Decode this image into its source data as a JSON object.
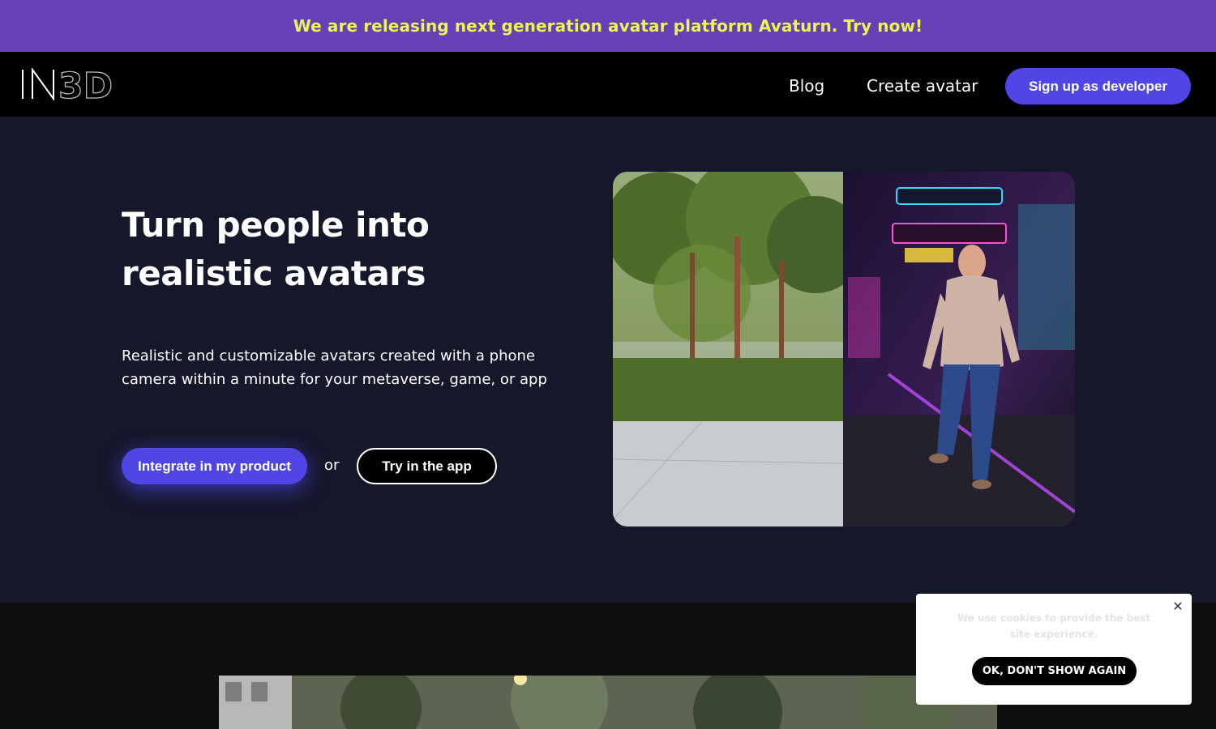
{
  "banner": {
    "text": "We are releasing next generation avatar platform Avaturn. Try now!"
  },
  "nav": {
    "logo_text": "IN3D",
    "links": [
      {
        "label": "Blog"
      },
      {
        "label": "Create avatar"
      }
    ],
    "signup_label": "Sign up as developer"
  },
  "hero": {
    "title": "Turn people into realistic avatars",
    "subtitle": "Realistic and customizable avatars created with a phone camera within a minute for your metaverse, game, or app",
    "primary_button": "Integrate in my product",
    "or_text": "or",
    "secondary_button": "Try in the app"
  },
  "cookie": {
    "text": "We use cookies to provide the best site experience.",
    "button": "OK, DON'T SHOW AGAIN"
  },
  "colors": {
    "banner_bg": "#6840b6",
    "banner_text": "#e8f55a",
    "accent": "#4f46e5",
    "hero_bg": "#15172a"
  }
}
